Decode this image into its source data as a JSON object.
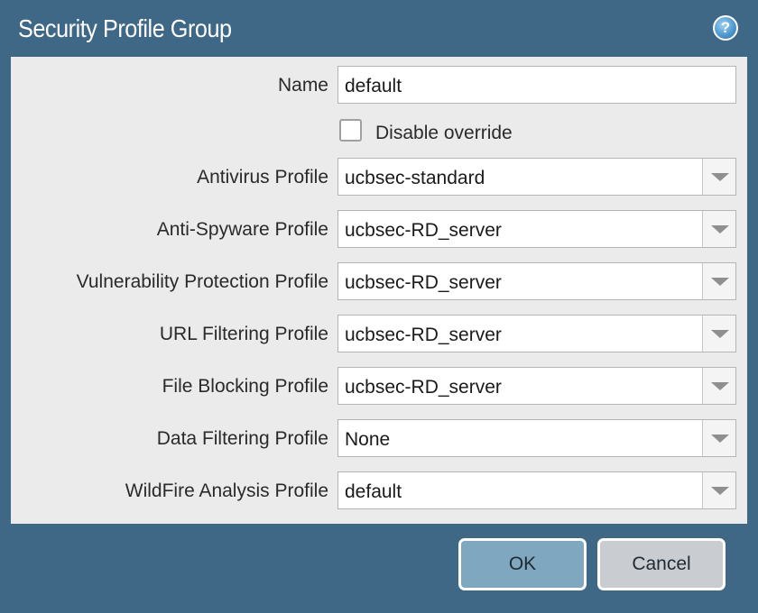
{
  "window": {
    "title": "Security Profile Group",
    "help_icon": "?"
  },
  "form": {
    "name": {
      "label": "Name",
      "value": "default"
    },
    "disable_override": {
      "label": "Disable override",
      "checked": false
    },
    "profiles": [
      {
        "label": "Antivirus Profile",
        "value": "ucbsec-standard"
      },
      {
        "label": "Anti-Spyware Profile",
        "value": "ucbsec-RD_server"
      },
      {
        "label": "Vulnerability Protection Profile",
        "value": "ucbsec-RD_server"
      },
      {
        "label": "URL Filtering Profile",
        "value": "ucbsec-RD_server"
      },
      {
        "label": "File Blocking Profile",
        "value": "ucbsec-RD_server"
      },
      {
        "label": "Data Filtering Profile",
        "value": "None"
      },
      {
        "label": "WildFire Analysis Profile",
        "value": "default"
      }
    ]
  },
  "buttons": {
    "ok": "OK",
    "cancel": "Cancel"
  },
  "colors": {
    "frame": "#3f6786",
    "panel": "#ebebeb",
    "ok_button": "#7fa7bf",
    "cancel_button": "#c9ccd1"
  }
}
